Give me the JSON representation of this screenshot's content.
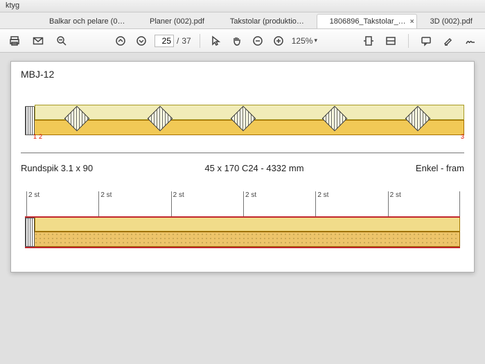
{
  "menubar": {
    "tools": "ktyg"
  },
  "tabs": [
    {
      "label": "Balkar och pelare (0…",
      "active": false
    },
    {
      "label": "Planer (002).pdf",
      "active": false
    },
    {
      "label": "Takstolar (produktio…",
      "active": false
    },
    {
      "label": "1806896_Takstolar_…",
      "active": true
    },
    {
      "label": "3D (002).pdf",
      "active": false
    }
  ],
  "toolbar": {
    "page_current": "25",
    "page_total": "37",
    "zoom": "125%"
  },
  "doc": {
    "section1": {
      "title": "MBJ-12",
      "red_left_1": "1",
      "red_left_2": "2",
      "red_right": "3",
      "plates_pct": [
        8,
        28,
        48,
        70,
        90
      ]
    },
    "section2": {
      "left": "Rundspik 3.1 x 90",
      "mid": "45 x 170 C24 - 4332 mm",
      "right": "Enkel - fram",
      "dim_segments": [
        "2 st",
        "2 st",
        "2 st",
        "2 st",
        "2 st",
        "2 st"
      ]
    }
  }
}
